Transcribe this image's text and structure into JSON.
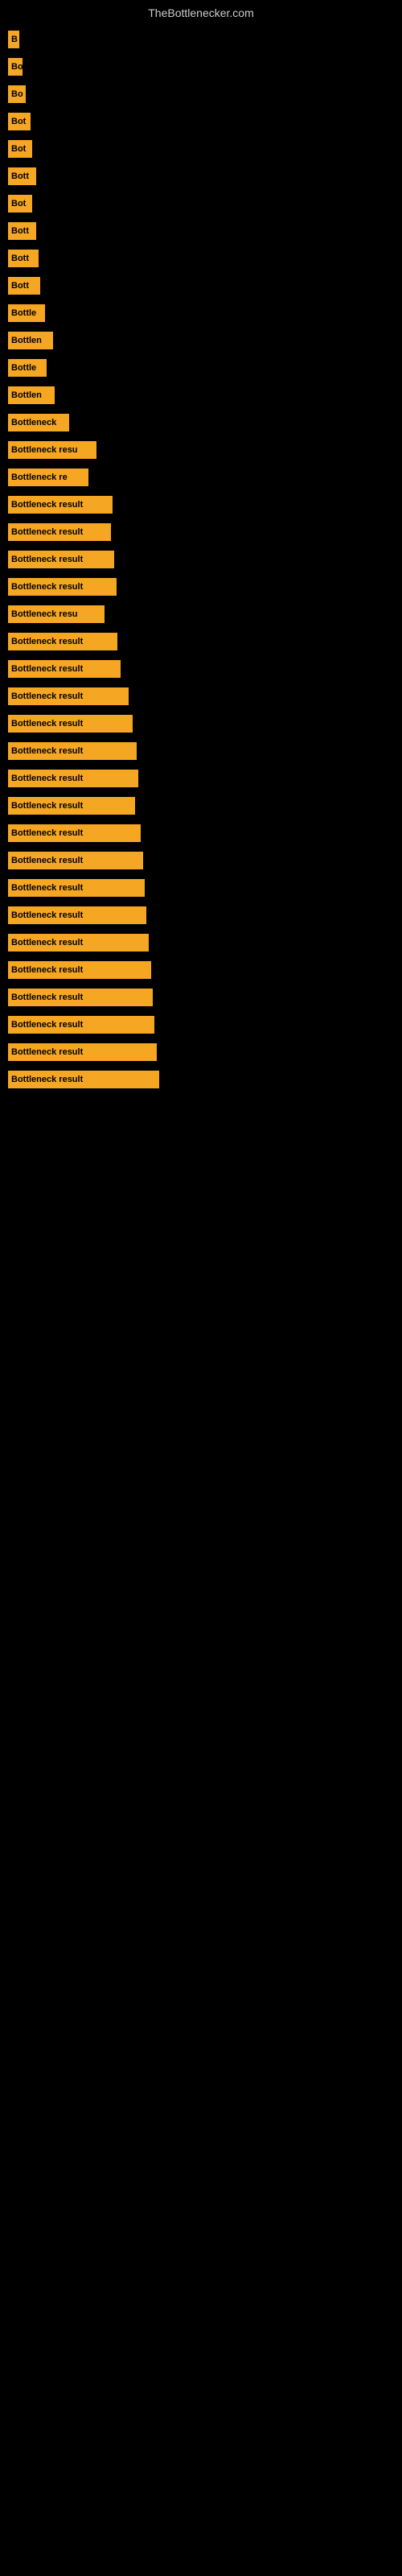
{
  "site_title": "TheBottlenecker.com",
  "bars": [
    {
      "label": "B",
      "width": 14
    },
    {
      "label": "Bo",
      "width": 18
    },
    {
      "label": "Bo",
      "width": 22
    },
    {
      "label": "Bot",
      "width": 28
    },
    {
      "label": "Bot",
      "width": 30
    },
    {
      "label": "Bott",
      "width": 35
    },
    {
      "label": "Bot",
      "width": 30
    },
    {
      "label": "Bott",
      "width": 35
    },
    {
      "label": "Bott",
      "width": 38
    },
    {
      "label": "Bott",
      "width": 40
    },
    {
      "label": "Bottle",
      "width": 46
    },
    {
      "label": "Bottlen",
      "width": 56
    },
    {
      "label": "Bottle",
      "width": 48
    },
    {
      "label": "Bottlen",
      "width": 58
    },
    {
      "label": "Bottleneck",
      "width": 76
    },
    {
      "label": "Bottleneck resu",
      "width": 110
    },
    {
      "label": "Bottleneck re",
      "width": 100
    },
    {
      "label": "Bottleneck result",
      "width": 130
    },
    {
      "label": "Bottleneck result",
      "width": 128
    },
    {
      "label": "Bottleneck result",
      "width": 132
    },
    {
      "label": "Bottleneck result",
      "width": 135
    },
    {
      "label": "Bottleneck resu",
      "width": 120
    },
    {
      "label": "Bottleneck result",
      "width": 136
    },
    {
      "label": "Bottleneck result",
      "width": 140
    },
    {
      "label": "Bottleneck result",
      "width": 150
    },
    {
      "label": "Bottleneck result",
      "width": 155
    },
    {
      "label": "Bottleneck result",
      "width": 160
    },
    {
      "label": "Bottleneck result",
      "width": 162
    },
    {
      "label": "Bottleneck result",
      "width": 158
    },
    {
      "label": "Bottleneck result",
      "width": 165
    },
    {
      "label": "Bottleneck result",
      "width": 168
    },
    {
      "label": "Bottleneck result",
      "width": 170
    },
    {
      "label": "Bottleneck result",
      "width": 172
    },
    {
      "label": "Bottleneck result",
      "width": 175
    },
    {
      "label": "Bottleneck result",
      "width": 178
    },
    {
      "label": "Bottleneck result",
      "width": 180
    },
    {
      "label": "Bottleneck result",
      "width": 182
    },
    {
      "label": "Bottleneck result",
      "width": 185
    },
    {
      "label": "Bottleneck result",
      "width": 188
    }
  ]
}
